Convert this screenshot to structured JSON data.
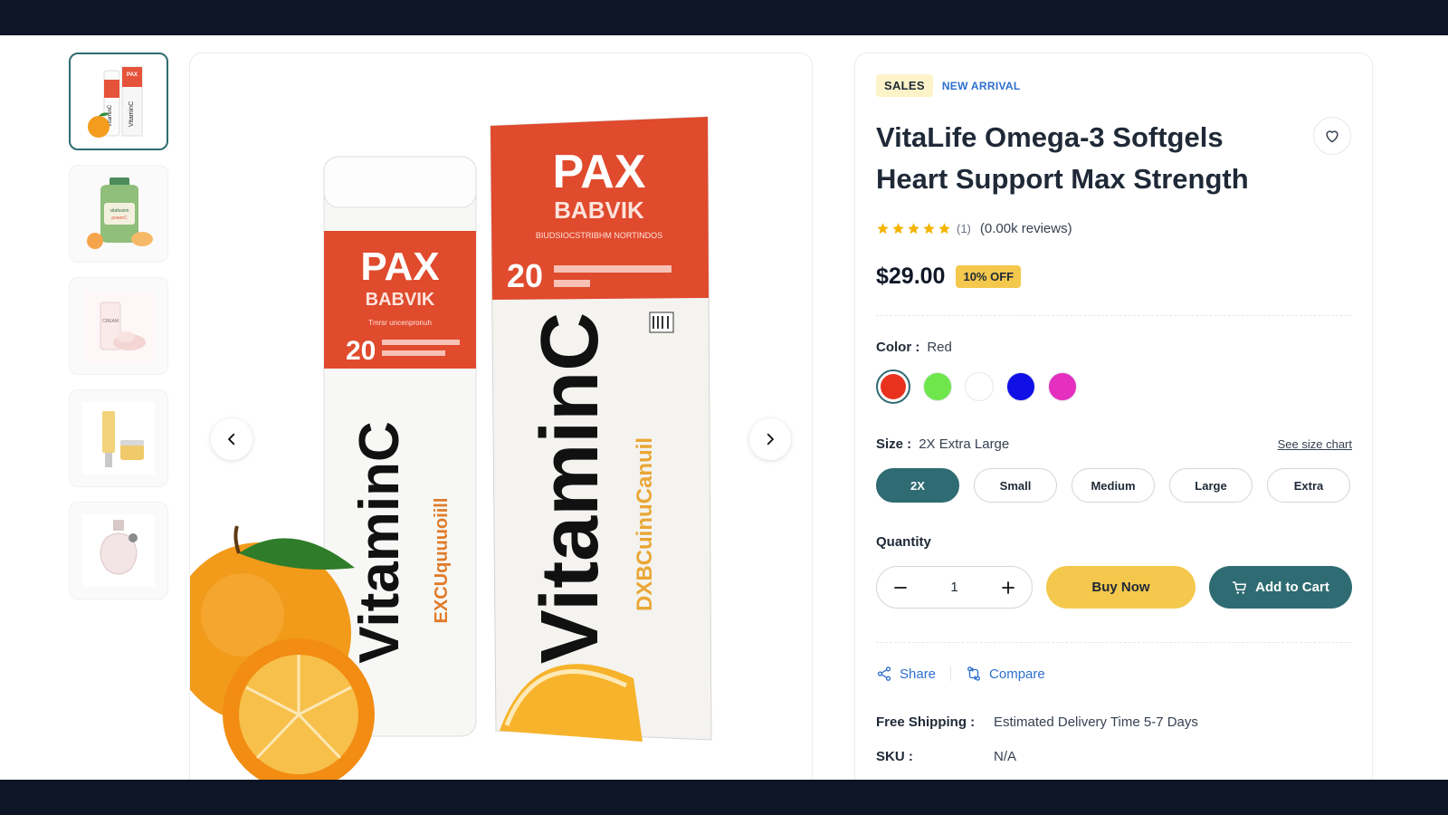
{
  "gallery": {
    "thumbnails": [
      {
        "name": "vitamin-c-tubes"
      },
      {
        "name": "vitafusion-jar"
      },
      {
        "name": "cream-tube"
      },
      {
        "name": "serum-and-jar"
      },
      {
        "name": "perfume-bottle"
      }
    ],
    "main_image": {
      "product": "vitamin-c-effervescent",
      "tube_brand": "PAX",
      "tube_sub": "BABVIK",
      "tube_count": "20",
      "tube_product": "VitaminC",
      "tube_side": "EXCUquuuoiill",
      "box_brand": "PAX",
      "box_sub": "BABVIK",
      "box_count": "20",
      "box_product": "VitaminC",
      "box_side": "DXBCuinuCanuil",
      "box_fine_print": "BIUDSIOCSTRIBHM NORTINDOS",
      "tube_fine_print": "Tmrsr uncenpronuh"
    }
  },
  "product": {
    "badge_sales": "SALES",
    "badge_new": "NEW ARRIVAL",
    "title": "VitaLife Omega-3 Softgels Heart Support Max Strength",
    "rating_value": 5,
    "rating_count": "(1)",
    "reviews": "(0.00k reviews)",
    "price": "$29.00",
    "discount": "10% OFF",
    "color_label": "Color :",
    "color_value": "Red",
    "colors": [
      "#e8321e",
      "#6ee64c",
      "#ffffff",
      "#1010e6",
      "#e42fbf"
    ],
    "size_label": "Size :",
    "size_value": "2X Extra Large",
    "size_chart": "See size chart",
    "sizes": [
      "2X",
      "Small",
      "Medium",
      "Large",
      "Extra"
    ],
    "selected_size": "2X",
    "quantity_label": "Quantity",
    "quantity": "1",
    "buy_now": "Buy Now",
    "add_to_cart": "Add to Cart",
    "share": "Share",
    "compare": "Compare",
    "shipping_label": "Free Shipping :",
    "shipping_value": "Estimated Delivery Time 5-7 Days",
    "sku_label": "SKU :",
    "sku_value": "N/A"
  },
  "colors": {
    "accent": "#2f6b72",
    "yellow": "#f4c84c",
    "link": "#2e6fcf",
    "star": "#f4b400",
    "header": "#0d1526"
  }
}
